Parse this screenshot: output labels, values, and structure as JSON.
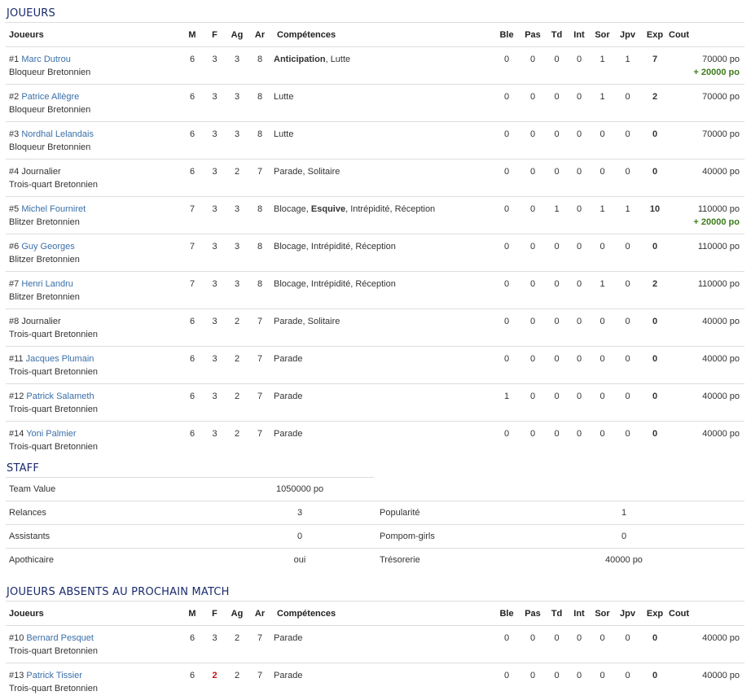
{
  "players_section": {
    "title": "JOUEURS",
    "headers": [
      "Joueurs",
      "M",
      "F",
      "Ag",
      "Ar",
      "Compétences",
      "Ble",
      "Pas",
      "Td",
      "Int",
      "Sor",
      "Jpv",
      "Exp",
      "Cout"
    ],
    "rows": [
      {
        "num": "#1",
        "name": "Marc Dutrou",
        "linked": true,
        "position": "Bloqueur Bretonnien",
        "m": "6",
        "f": "3",
        "ag": "3",
        "ar": "8",
        "skills": [
          {
            "t": "Anticipation",
            "b": true
          },
          {
            "t": "Lutte",
            "b": false
          }
        ],
        "ble": "0",
        "pas": "0",
        "td": "0",
        "int": "0",
        "sor": "1",
        "jpv": "1",
        "exp": "7",
        "cost": "70000 po",
        "bonus": "+ 20000 po"
      },
      {
        "num": "#2",
        "name": "Patrice Allègre",
        "linked": true,
        "position": "Bloqueur Bretonnien",
        "m": "6",
        "f": "3",
        "ag": "3",
        "ar": "8",
        "skills": [
          {
            "t": "Lutte",
            "b": false
          }
        ],
        "ble": "0",
        "pas": "0",
        "td": "0",
        "int": "0",
        "sor": "1",
        "jpv": "0",
        "exp": "2",
        "cost": "70000 po",
        "bonus": ""
      },
      {
        "num": "#3",
        "name": "Nordhal Lelandais",
        "linked": true,
        "position": "Bloqueur Bretonnien",
        "m": "6",
        "f": "3",
        "ag": "3",
        "ar": "8",
        "skills": [
          {
            "t": "Lutte",
            "b": false
          }
        ],
        "ble": "0",
        "pas": "0",
        "td": "0",
        "int": "0",
        "sor": "0",
        "jpv": "0",
        "exp": "0",
        "cost": "70000 po",
        "bonus": ""
      },
      {
        "num": "#4",
        "name": "Journalier",
        "linked": false,
        "position": "Trois-quart Bretonnien",
        "m": "6",
        "f": "3",
        "ag": "2",
        "ar": "7",
        "skills": [
          {
            "t": "Parade",
            "b": false
          },
          {
            "t": "Solitaire",
            "b": false
          }
        ],
        "ble": "0",
        "pas": "0",
        "td": "0",
        "int": "0",
        "sor": "0",
        "jpv": "0",
        "exp": "0",
        "cost": "40000 po",
        "bonus": ""
      },
      {
        "num": "#5",
        "name": "Michel Fourniret",
        "linked": true,
        "position": "Blitzer Bretonnien",
        "m": "7",
        "f": "3",
        "ag": "3",
        "ar": "8",
        "skills": [
          {
            "t": "Blocage",
            "b": false
          },
          {
            "t": "Esquive",
            "b": true
          },
          {
            "t": "Intrépidité",
            "b": false
          },
          {
            "t": "Réception",
            "b": false
          }
        ],
        "ble": "0",
        "pas": "0",
        "td": "1",
        "int": "0",
        "sor": "1",
        "jpv": "1",
        "exp": "10",
        "cost": "110000 po",
        "bonus": "+ 20000 po"
      },
      {
        "num": "#6",
        "name": "Guy Georges",
        "linked": true,
        "position": "Blitzer Bretonnien",
        "m": "7",
        "f": "3",
        "ag": "3",
        "ar": "8",
        "skills": [
          {
            "t": "Blocage",
            "b": false
          },
          {
            "t": "Intrépidité",
            "b": false
          },
          {
            "t": "Réception",
            "b": false
          }
        ],
        "ble": "0",
        "pas": "0",
        "td": "0",
        "int": "0",
        "sor": "0",
        "jpv": "0",
        "exp": "0",
        "cost": "110000 po",
        "bonus": ""
      },
      {
        "num": "#7",
        "name": "Henri Landru",
        "linked": true,
        "position": "Blitzer Bretonnien",
        "m": "7",
        "f": "3",
        "ag": "3",
        "ar": "8",
        "skills": [
          {
            "t": "Blocage",
            "b": false
          },
          {
            "t": "Intrépidité",
            "b": false
          },
          {
            "t": "Réception",
            "b": false
          }
        ],
        "ble": "0",
        "pas": "0",
        "td": "0",
        "int": "0",
        "sor": "1",
        "jpv": "0",
        "exp": "2",
        "cost": "110000 po",
        "bonus": ""
      },
      {
        "num": "#8",
        "name": "Journalier",
        "linked": false,
        "position": "Trois-quart Bretonnien",
        "m": "6",
        "f": "3",
        "ag": "2",
        "ar": "7",
        "skills": [
          {
            "t": "Parade",
            "b": false
          },
          {
            "t": "Solitaire",
            "b": false
          }
        ],
        "ble": "0",
        "pas": "0",
        "td": "0",
        "int": "0",
        "sor": "0",
        "jpv": "0",
        "exp": "0",
        "cost": "40000 po",
        "bonus": ""
      },
      {
        "num": "#11",
        "name": "Jacques Plumain",
        "linked": true,
        "position": "Trois-quart Bretonnien",
        "m": "6",
        "f": "3",
        "ag": "2",
        "ar": "7",
        "skills": [
          {
            "t": "Parade",
            "b": false
          }
        ],
        "ble": "0",
        "pas": "0",
        "td": "0",
        "int": "0",
        "sor": "0",
        "jpv": "0",
        "exp": "0",
        "cost": "40000 po",
        "bonus": ""
      },
      {
        "num": "#12",
        "name": "Patrick Salameth",
        "linked": true,
        "position": "Trois-quart Bretonnien",
        "m": "6",
        "f": "3",
        "ag": "2",
        "ar": "7",
        "skills": [
          {
            "t": "Parade",
            "b": false
          }
        ],
        "ble": "1",
        "pas": "0",
        "td": "0",
        "int": "0",
        "sor": "0",
        "jpv": "0",
        "exp": "0",
        "cost": "40000 po",
        "bonus": ""
      },
      {
        "num": "#14",
        "name": "Yoni Palmier",
        "linked": true,
        "position": "Trois-quart Bretonnien",
        "m": "6",
        "f": "3",
        "ag": "2",
        "ar": "7",
        "skills": [
          {
            "t": "Parade",
            "b": false
          }
        ],
        "ble": "0",
        "pas": "0",
        "td": "0",
        "int": "0",
        "sor": "0",
        "jpv": "0",
        "exp": "0",
        "cost": "40000 po",
        "bonus": ""
      }
    ]
  },
  "staff": {
    "title": "STAFF",
    "team_value_label": "Team Value",
    "team_value": "1050000 po",
    "rows": [
      {
        "l1": "Relances",
        "v1": "3",
        "l2": "Popularité",
        "v2": "1"
      },
      {
        "l1": "Assistants",
        "v1": "0",
        "l2": "Pompom-girls",
        "v2": "0"
      },
      {
        "l1": "Apothicaire",
        "v1": "oui",
        "l2": "Trésorerie",
        "v2": "40000 po"
      }
    ]
  },
  "absent_section": {
    "title": "JOUEURS ABSENTS AU PROCHAIN MATCH",
    "headers": [
      "Joueurs",
      "M",
      "F",
      "Ag",
      "Ar",
      "Compétences",
      "Ble",
      "Pas",
      "Td",
      "Int",
      "Sor",
      "Jpv",
      "Exp",
      "Cout"
    ],
    "rows": [
      {
        "num": "#10",
        "name": "Bernard Pesquet",
        "linked": true,
        "position": "Trois-quart Bretonnien",
        "m": "6",
        "f": "3",
        "f_red": false,
        "ag": "2",
        "ar": "7",
        "skills": [
          {
            "t": "Parade",
            "b": false
          }
        ],
        "ble": "0",
        "pas": "0",
        "td": "0",
        "int": "0",
        "sor": "0",
        "jpv": "0",
        "exp": "0",
        "cost": "40000 po",
        "bonus": ""
      },
      {
        "num": "#13",
        "name": "Patrick Tissier",
        "linked": true,
        "position": "Trois-quart Bretonnien",
        "m": "6",
        "f": "2",
        "f_red": true,
        "ag": "2",
        "ar": "7",
        "skills": [
          {
            "t": "Parade",
            "b": false
          }
        ],
        "ble": "0",
        "pas": "0",
        "td": "0",
        "int": "0",
        "sor": "0",
        "jpv": "0",
        "exp": "0",
        "cost": "40000 po",
        "bonus": ""
      }
    ]
  },
  "colors": {
    "heading": "#1a2a6c",
    "link": "#3a6fa8",
    "bonus": "#3c7c1c",
    "penalty": "#cc1111",
    "rule": "#dddddd"
  }
}
